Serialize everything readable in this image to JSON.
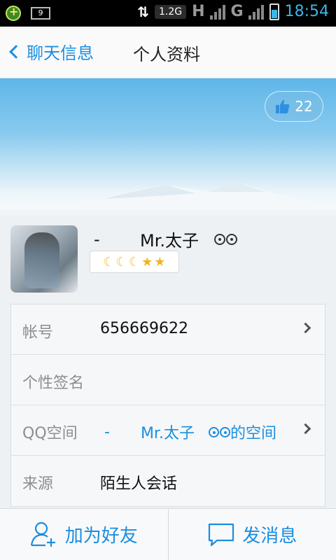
{
  "status_bar": {
    "notification_badge": "9",
    "data_speed": "1.2G",
    "network_1": "H",
    "network_2": "G",
    "time": "18:54"
  },
  "header": {
    "back_label": "聊天信息",
    "title": "个人资料"
  },
  "cover": {
    "like_count": "22"
  },
  "profile": {
    "nickname_prefix": "-",
    "nickname": "Mr.太子"
  },
  "info": {
    "account_label": "帐号",
    "account_value": "656669622",
    "signature_label": "个性签名",
    "signature_value": "",
    "qzone_label": "QQ空间",
    "qzone_prefix": "-",
    "qzone_name": "Mr.太子",
    "qzone_suffix": "的空间",
    "source_label": "来源",
    "source_value": "陌生人会话"
  },
  "actions": {
    "add_friend": "加为好友",
    "send_message": "发消息"
  },
  "colors": {
    "accent": "#1b8ee0",
    "time": "#39b7e8"
  }
}
